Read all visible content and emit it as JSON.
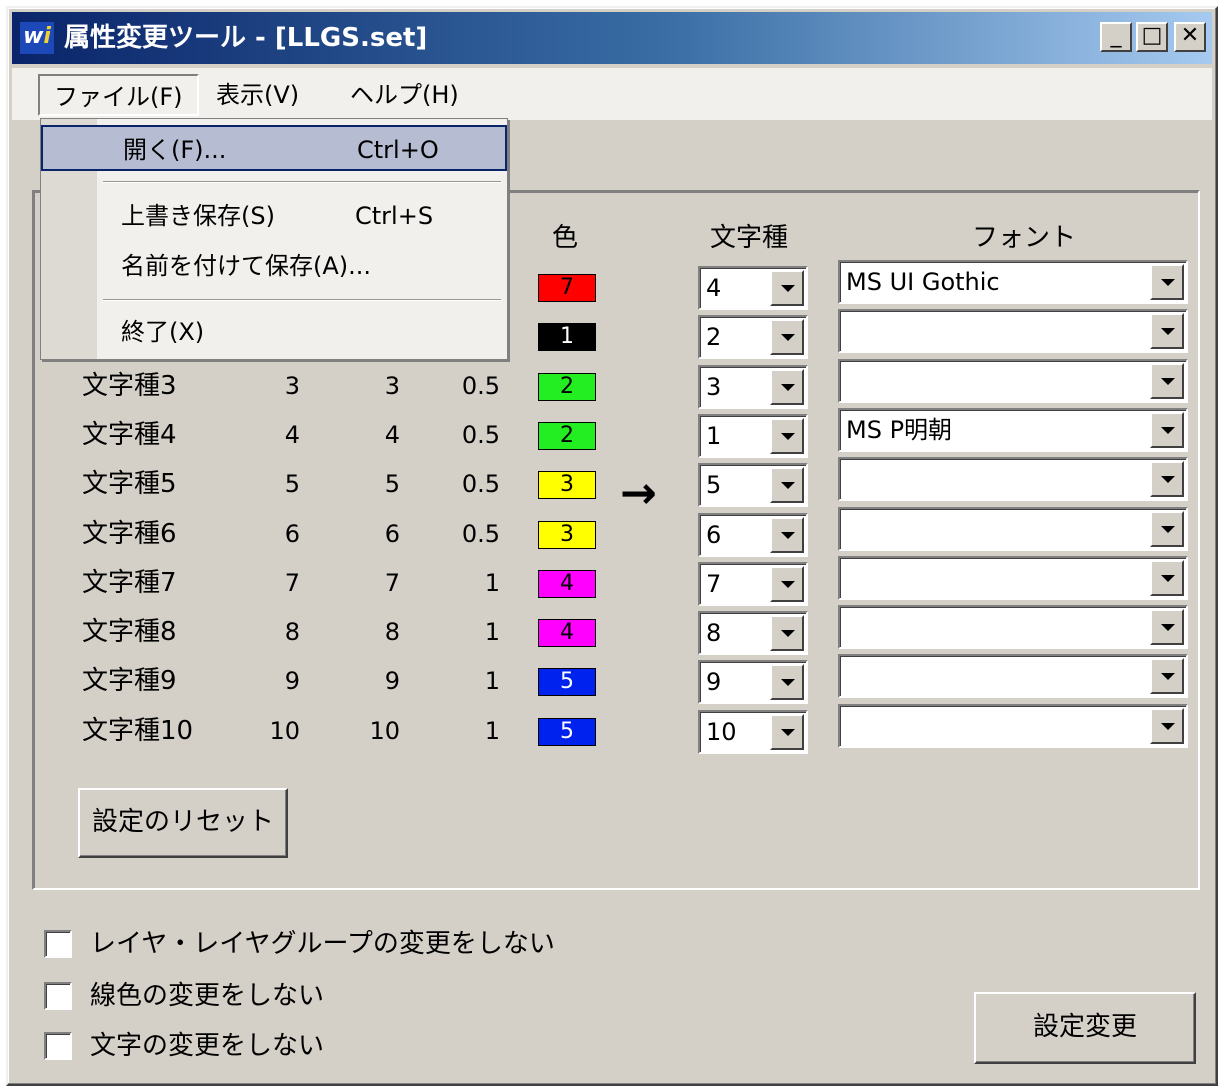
{
  "window": {
    "title": "属性変更ツール - [LLGS.set]",
    "icon_text_main": "w",
    "icon_text_accent": "i",
    "minimize_label": "_",
    "maximize_label": "□",
    "close_label": "✕"
  },
  "menubar": {
    "items": [
      {
        "label": "ファイル(F)"
      },
      {
        "label": "表示(V)"
      },
      {
        "label": "ヘルプ(H)"
      }
    ]
  },
  "file_menu": {
    "items": [
      {
        "label": "開く(F)...",
        "shortcut": "Ctrl+O"
      },
      {
        "label": "上書き保存(S)",
        "shortcut": "Ctrl+S"
      },
      {
        "label": "名前を付けて保存(A)...",
        "shortcut": ""
      },
      {
        "label": "終了(X)",
        "shortcut": ""
      }
    ]
  },
  "table": {
    "headers": {
      "color": "色",
      "char_type": "文字種",
      "font": "フォント"
    },
    "rows": [
      {
        "name": "",
        "a": "",
        "b": "",
        "c": "",
        "color_num": "7",
        "color": "#ff0000",
        "text_color": "#000000",
        "char_type": "4",
        "font": "MS UI Gothic"
      },
      {
        "name": "",
        "a": "",
        "b": "",
        "c": "",
        "color_num": "1",
        "color": "#000000",
        "text_color": "#ffffff",
        "char_type": "2",
        "font": ""
      },
      {
        "name": "文字種3",
        "a": "3",
        "b": "3",
        "c": "0.5",
        "color_num": "2",
        "color": "#22ee22",
        "text_color": "#000000",
        "char_type": "3",
        "font": ""
      },
      {
        "name": "文字種4",
        "a": "4",
        "b": "4",
        "c": "0.5",
        "color_num": "2",
        "color": "#22ee22",
        "text_color": "#000000",
        "char_type": "1",
        "font": "MS P明朝"
      },
      {
        "name": "文字種5",
        "a": "5",
        "b": "5",
        "c": "0.5",
        "color_num": "3",
        "color": "#ffff00",
        "text_color": "#000000",
        "char_type": "5",
        "font": ""
      },
      {
        "name": "文字種6",
        "a": "6",
        "b": "6",
        "c": "0.5",
        "color_num": "3",
        "color": "#ffff00",
        "text_color": "#000000",
        "char_type": "6",
        "font": ""
      },
      {
        "name": "文字種7",
        "a": "7",
        "b": "7",
        "c": "1",
        "color_num": "4",
        "color": "#ff00ff",
        "text_color": "#000000",
        "char_type": "7",
        "font": ""
      },
      {
        "name": "文字種8",
        "a": "8",
        "b": "8",
        "c": "1",
        "color_num": "4",
        "color": "#ff00ff",
        "text_color": "#000000",
        "char_type": "8",
        "font": ""
      },
      {
        "name": "文字種9",
        "a": "9",
        "b": "9",
        "c": "1",
        "color_num": "5",
        "color": "#0022ee",
        "text_color": "#ffffff",
        "char_type": "9",
        "font": ""
      },
      {
        "name": "文字種10",
        "a": "10",
        "b": "10",
        "c": "1",
        "color_num": "5",
        "color": "#0022ee",
        "text_color": "#ffffff",
        "char_type": "10",
        "font": ""
      }
    ]
  },
  "arrow": "→",
  "reset_button": "設定のリセット",
  "options": [
    {
      "label": "レイヤ・レイヤグループの変更をしない",
      "checked": false
    },
    {
      "label": "線色の変更をしない",
      "checked": false
    },
    {
      "label": "文字の変更をしない",
      "checked": false
    }
  ],
  "apply_button": "設定変更",
  "colors": {
    "title_start": "#0a246a",
    "title_end": "#a6caf0",
    "face": "#d4d0c8",
    "menu_highlight": "#b6bdd2"
  }
}
